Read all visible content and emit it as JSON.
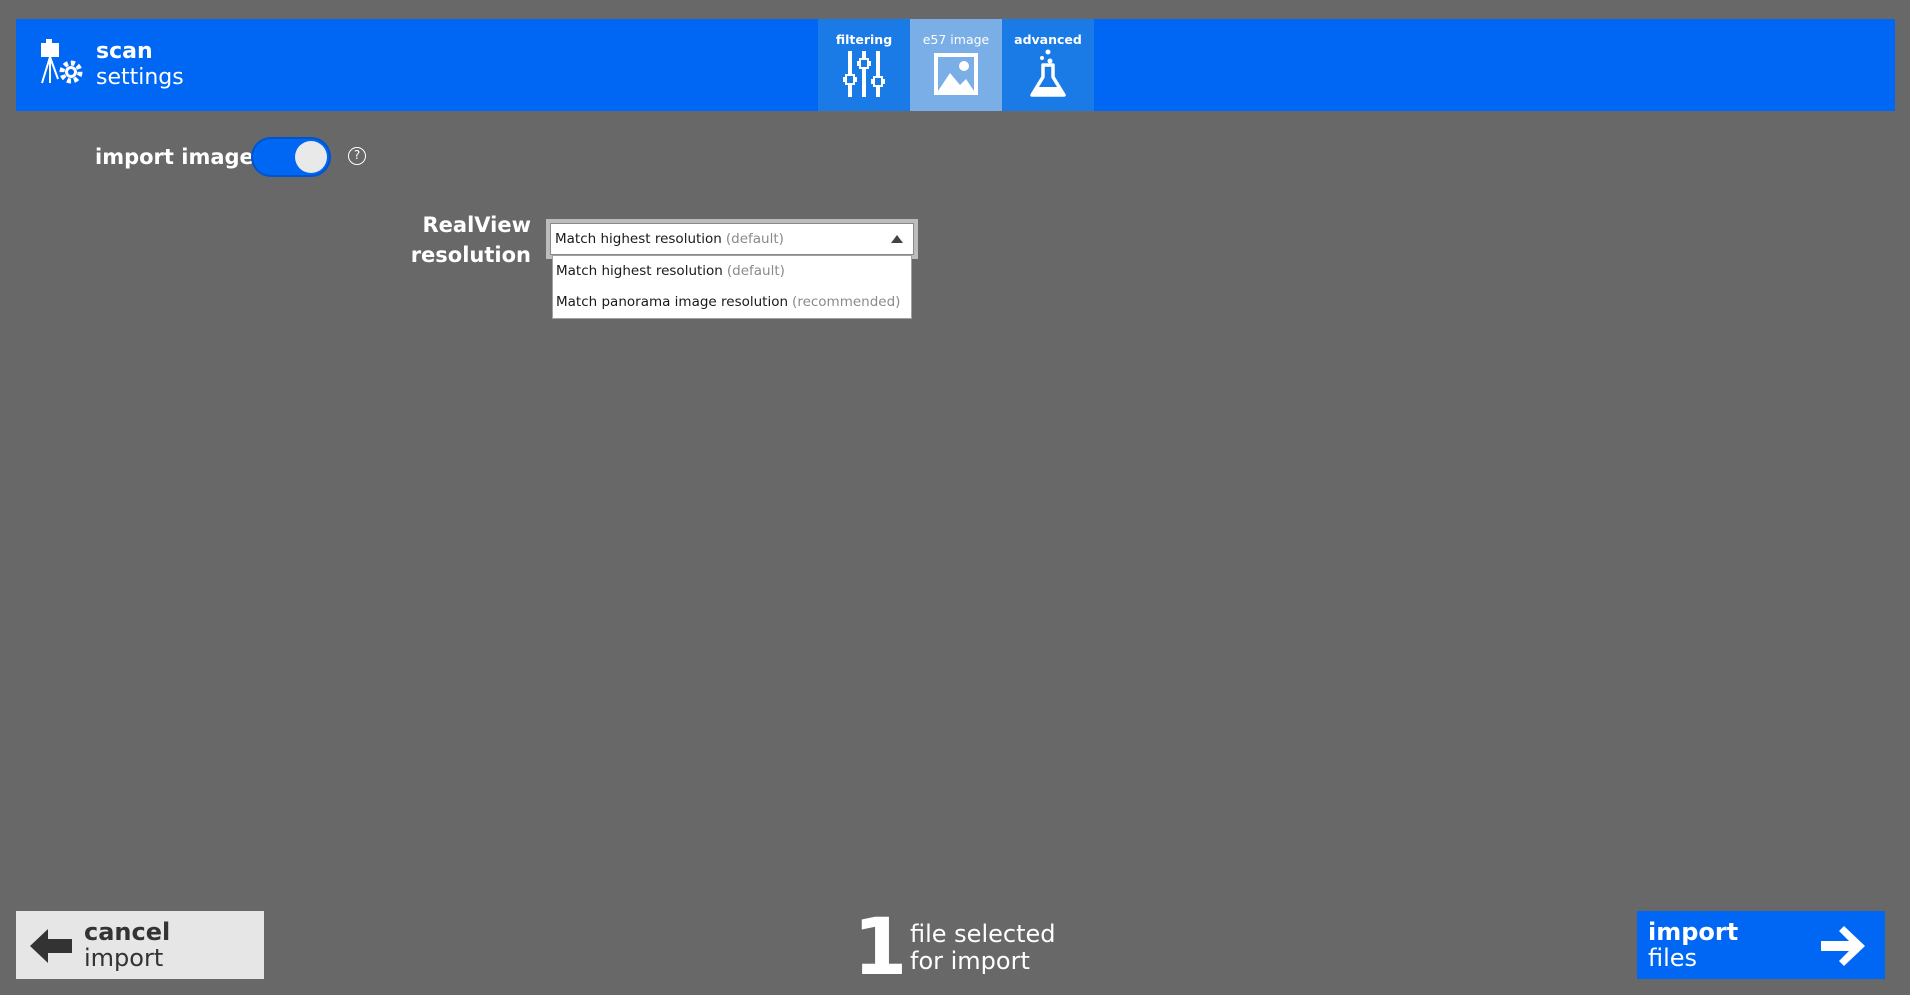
{
  "header": {
    "title_line1": "scan",
    "title_line2": "settings",
    "icon": "scanner-gear-icon",
    "color": "#0067f4"
  },
  "tabs": [
    {
      "label": "filtering",
      "icon": "sliders-icon",
      "active": false
    },
    {
      "label": "e57 image",
      "icon": "image-icon",
      "active": true
    },
    {
      "label": "advanced",
      "icon": "flask-icon",
      "active": false
    }
  ],
  "import_image": {
    "label": "import image",
    "toggle_on": true,
    "help_glyph": "?"
  },
  "realview": {
    "label_line1": "RealView",
    "label_line2": "resolution",
    "selected": {
      "text": "Match highest resolution",
      "hint": "(default)"
    },
    "options": [
      {
        "text": "Match highest resolution",
        "hint": "(default)"
      },
      {
        "text": "Match panorama image resolution",
        "hint": "(recommended)"
      }
    ]
  },
  "footer": {
    "cancel_line1": "cancel",
    "cancel_line2": "import",
    "count": "1",
    "count_line1": "file selected",
    "count_line2": "for import",
    "import_line1": "import",
    "import_line2": "files"
  }
}
